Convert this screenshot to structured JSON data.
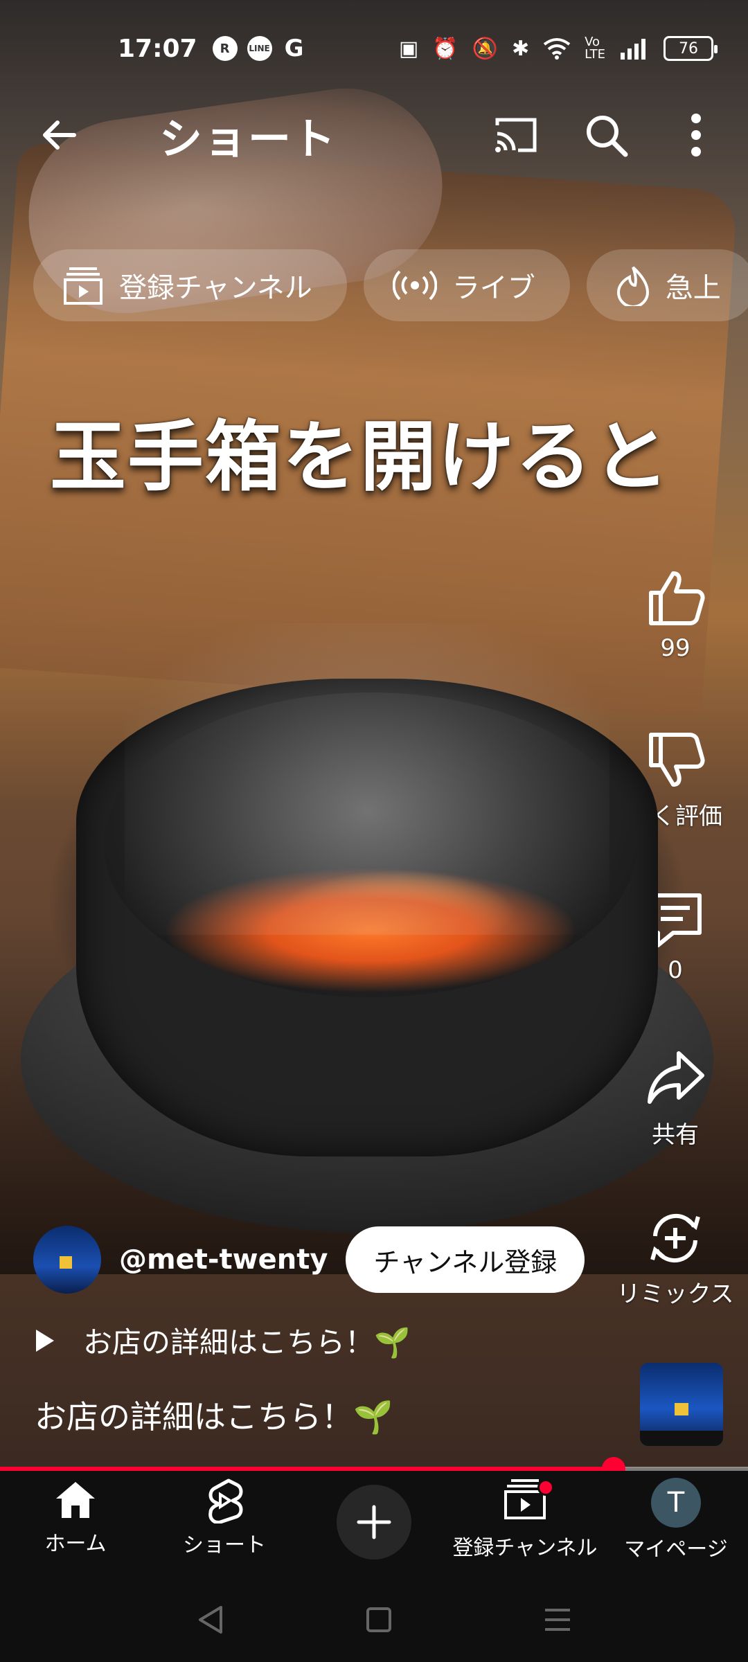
{
  "status_bar": {
    "time": "17:07",
    "app_icons": [
      "R",
      "LINE",
      "G"
    ],
    "battery": "76"
  },
  "header": {
    "title": "ショート",
    "icons": [
      "back-arrow-icon",
      "cast-icon",
      "search-icon",
      "more-vert-icon"
    ]
  },
  "chips": [
    {
      "label": "登録チャンネル",
      "icon": "subscriptions-icon"
    },
    {
      "label": "ライブ",
      "icon": "live-icon"
    },
    {
      "label": "急上",
      "icon": "trending-icon"
    }
  ],
  "video": {
    "caption": "玉手箱を開けると",
    "progress_percent": 82
  },
  "actions": {
    "like_count": "99",
    "dislike_label": "低く評価",
    "comment_count": "0",
    "share_label": "共有",
    "remix_label": "リミックス"
  },
  "channel": {
    "handle": "@met-twenty",
    "subscribe_label": "チャンネル登録"
  },
  "description": {
    "expand_text": "お店の詳細はこちら！🌱",
    "title": "お店の詳細はこちら！🌱"
  },
  "bottom_nav": [
    {
      "label": "ホーム",
      "icon": "home-icon"
    },
    {
      "label": "ショート",
      "icon": "shorts-icon"
    },
    {
      "label": "",
      "icon": "create-icon"
    },
    {
      "label": "登録チャンネル",
      "icon": "subscriptions-icon"
    },
    {
      "label": "マイページ",
      "icon": "avatar",
      "initial": "T"
    }
  ],
  "colors": {
    "accent": "#ff0033",
    "nav_background": "#0f0f0f"
  }
}
